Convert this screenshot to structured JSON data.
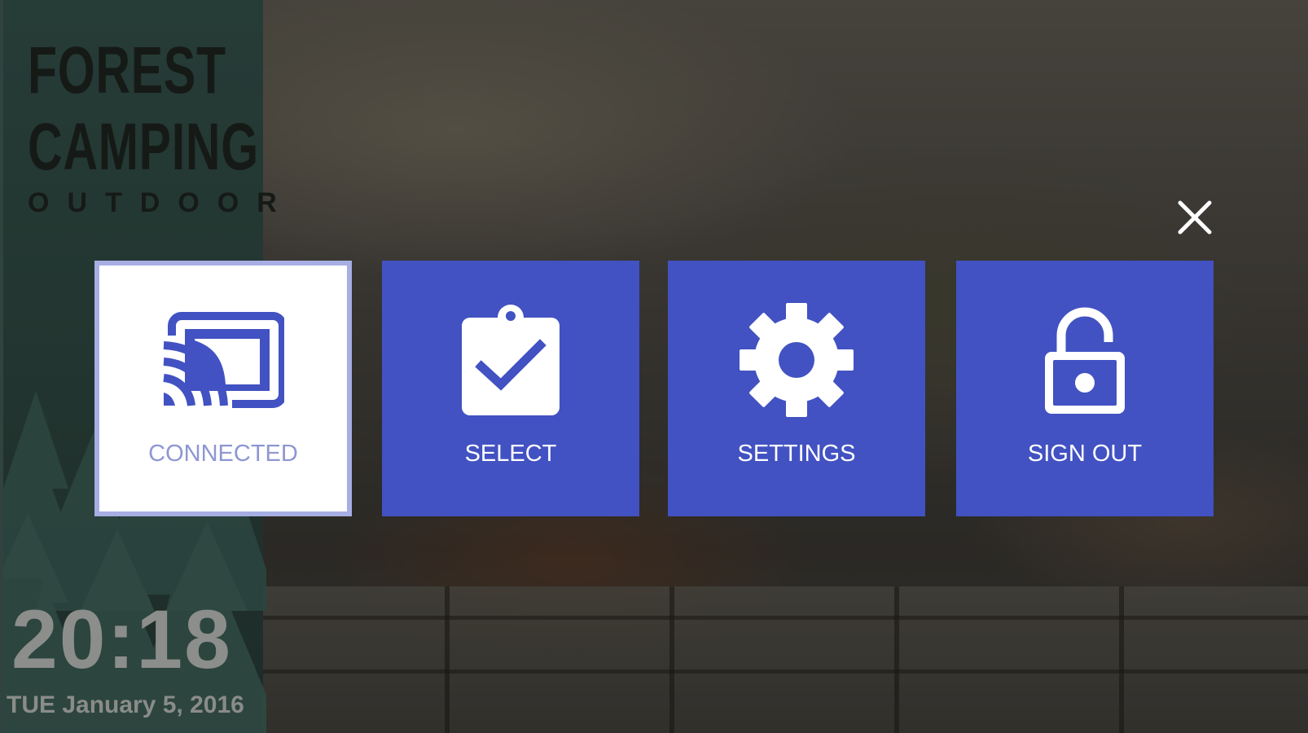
{
  "brand": {
    "line1": "FOREST",
    "line2": "CAMPING",
    "line3": "OUTDOOR"
  },
  "clock": {
    "time": "20:18",
    "date": "TUE January 5, 2016"
  },
  "menu": {
    "tiles": [
      {
        "label": "CONNECTED",
        "icon": "cast-icon",
        "selected": true
      },
      {
        "label": "SELECT",
        "icon": "clipboard-check-icon",
        "selected": false
      },
      {
        "label": "SETTINGS",
        "icon": "gear-icon",
        "selected": false
      },
      {
        "label": "SIGN OUT",
        "icon": "unlock-icon",
        "selected": false
      }
    ],
    "close_icon": "close-icon"
  },
  "colors": {
    "tile": "#4252c2",
    "tile_selected_bg": "#ffffff",
    "tile_selected_text": "#8e97d2",
    "side_panel": "#263c37"
  }
}
